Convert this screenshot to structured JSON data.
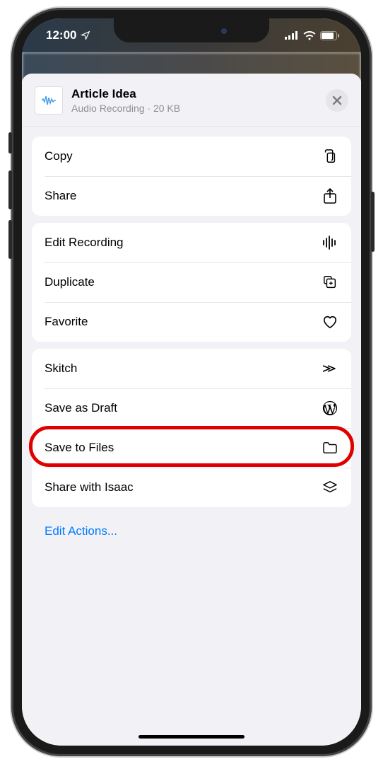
{
  "status": {
    "time": "12:00"
  },
  "header": {
    "title": "Article Idea",
    "subtitle": "Audio Recording · 20 KB"
  },
  "groups": [
    {
      "items": [
        {
          "label": "Copy",
          "icon": "copy-icon"
        },
        {
          "label": "Share",
          "icon": "share-icon"
        }
      ]
    },
    {
      "items": [
        {
          "label": "Edit Recording",
          "icon": "waveform-icon"
        },
        {
          "label": "Duplicate",
          "icon": "duplicate-icon"
        },
        {
          "label": "Favorite",
          "icon": "heart-icon"
        }
      ]
    },
    {
      "items": [
        {
          "label": "Skitch",
          "icon": "skitch-icon"
        },
        {
          "label": "Save as Draft",
          "icon": "wordpress-icon"
        },
        {
          "label": "Save to Files",
          "icon": "folder-icon"
        },
        {
          "label": "Share with Isaac",
          "icon": "stack-icon"
        }
      ]
    }
  ],
  "footer": {
    "edit_actions": "Edit Actions..."
  },
  "highlighted_item_label": "Save to Files"
}
